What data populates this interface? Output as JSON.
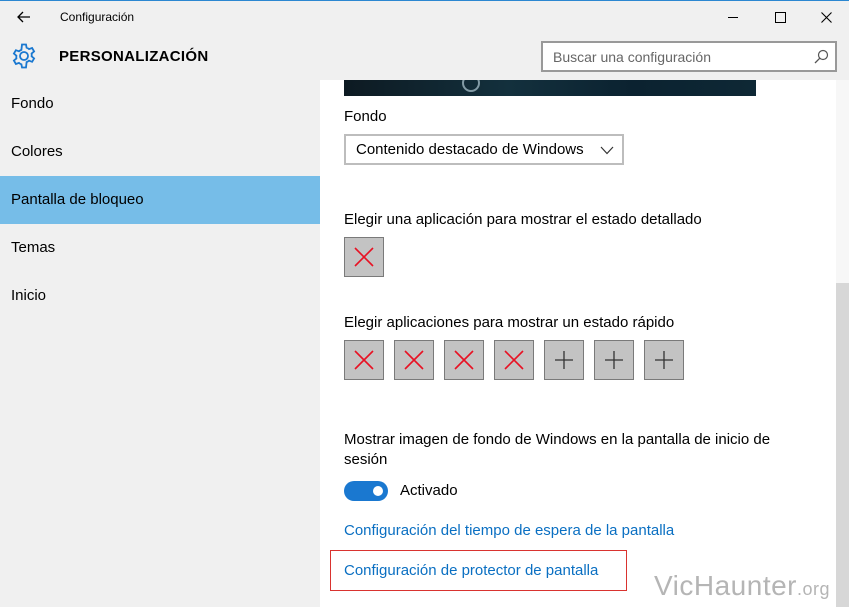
{
  "window": {
    "title": "Configuración",
    "accent_color": "#2b87d1"
  },
  "header": {
    "section_title": "PERSONALIZACIÓN",
    "icon": "gear-icon"
  },
  "search": {
    "placeholder": "Buscar una configuración",
    "value": ""
  },
  "sidebar": {
    "items": [
      {
        "label": "Fondo"
      },
      {
        "label": "Colores"
      },
      {
        "label": "Pantalla de bloqueo",
        "selected": true
      },
      {
        "label": "Temas"
      },
      {
        "label": "Inicio"
      }
    ],
    "selected_color": "#76bde8"
  },
  "main": {
    "background_label": "Fondo",
    "background_dropdown_value": "Contenido destacado de Windows",
    "detailed_status_label": "Elegir una aplicación para mostrar el estado detallado",
    "detailed_status_slots": [
      "empty-x"
    ],
    "quick_status_label": "Elegir aplicaciones para mostrar un estado rápido",
    "quick_status_slots": [
      "empty-x",
      "empty-x",
      "empty-x",
      "empty-x",
      "add",
      "add",
      "add"
    ],
    "show_bg_label": "Mostrar imagen de fondo de Windows en la pantalla de inicio de sesión",
    "toggle_state_label": "Activado",
    "toggle_on": true,
    "screen_timeout_link": "Configuración del tiempo de espera de la pantalla",
    "screensaver_link": "Configuración de protector de pantalla"
  },
  "watermark": {
    "main": "VicHaunter",
    "suffix": ".org"
  }
}
